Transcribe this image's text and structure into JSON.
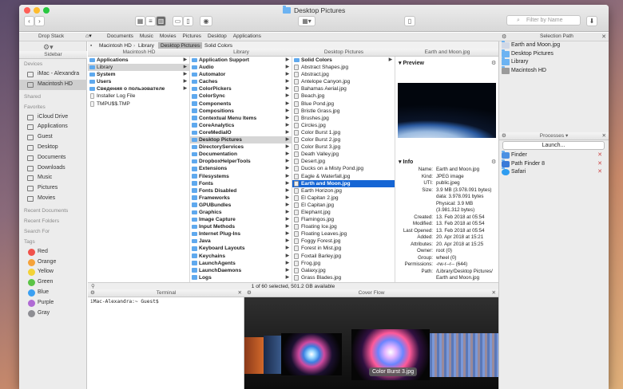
{
  "window": {
    "title": "Desktop Pictures",
    "filter_placeholder": "Filter by Name"
  },
  "pathbar": {
    "items": [
      "Documents",
      "Music",
      "Movies",
      "Pictures",
      "Desktop",
      "Applications"
    ]
  },
  "left_panel": {
    "drop_stack_label": "Drop Stack",
    "sidebar_label": "Sidebar",
    "devices_header": "Devices",
    "devices": [
      "iMac - Alexandra",
      "Macintosh HD"
    ],
    "shared_header": "Shared",
    "favorites_header": "Favorites",
    "favorites": [
      "iCloud Drive",
      "Applications",
      "Guest",
      "Desktop",
      "Documents",
      "Downloads",
      "Music",
      "Pictures",
      "Movies"
    ],
    "recent_docs": "Recent Documents",
    "recent_folders": "Recent Folders",
    "search_for": "Search For",
    "tags_header": "Tags",
    "tags": [
      {
        "name": "Red",
        "color": "#f0524b"
      },
      {
        "name": "Orange",
        "color": "#f5a23a"
      },
      {
        "name": "Yellow",
        "color": "#f3d237"
      },
      {
        "name": "Green",
        "color": "#5bc446"
      },
      {
        "name": "Blue",
        "color": "#3ba0f2"
      },
      {
        "name": "Purple",
        "color": "#b06ad4"
      },
      {
        "name": "Gray",
        "color": "#8e8e93"
      }
    ]
  },
  "breadcrumb": [
    "Macintosh HD",
    "Library",
    "Desktop Pictures",
    "Solid Colors"
  ],
  "columns": {
    "c1": {
      "title": "Macintosh HD",
      "items": [
        {
          "n": "Applications",
          "b": 1,
          "a": 1
        },
        {
          "n": "Library",
          "a": 1,
          "s": 1
        },
        {
          "n": "System",
          "b": 1,
          "a": 1
        },
        {
          "n": "Users",
          "b": 1,
          "a": 1
        },
        {
          "n": "Сведения о пользователе",
          "b": 1,
          "a": 1
        },
        {
          "n": "Installer Log File",
          "d": 1
        },
        {
          "n": "TMPU$$.TMP",
          "d": 1
        }
      ]
    },
    "c2": {
      "title": "Library",
      "items": [
        "Application Support",
        "Audio",
        "Automator",
        "Caches",
        "ColorPickers",
        "ColorSync",
        "Components",
        "Compositions",
        "Contextual Menu Items",
        "CoreAnalytics",
        "CoreMediaIO",
        "Desktop Pictures",
        "DirectoryServices",
        "Documentation",
        "DropboxHelperTools",
        "Extensions",
        "Filesystems",
        "Fonts",
        "Fonts Disabled",
        "Frameworks",
        "GPUBundles",
        "Graphics",
        "Image Capture",
        "Input Methods",
        "Internet Plug-Ins",
        "Java",
        "Keyboard Layouts",
        "Keychains",
        "LaunchAgents",
        "LaunchDaemons",
        "Logs"
      ]
    },
    "c3": {
      "title": "Desktop Pictures",
      "items": [
        "Solid Colors",
        "Abstract Shapes.jpg",
        "Abstract.jpg",
        "Antelope Canyon.jpg",
        "Bahamas Aerial.jpg",
        "Beach.jpg",
        "Blue Pond.jpg",
        "Bristle Grass.jpg",
        "Brushes.jpg",
        "Circles.jpg",
        "Color Burst 1.jpg",
        "Color Burst 2.jpg",
        "Color Burst 3.jpg",
        "Death Valley.jpg",
        "Desert.jpg",
        "Ducks on a Misty Pond.jpg",
        "Eagle & Waterfall.jpg",
        "Earth and Moon.jpg",
        "Earth Horizon.jpg",
        "El Capitan 2.jpg",
        "El Capitan.jpg",
        "Elephant.jpg",
        "Flamingos.jpg",
        "Floating Ice.jpg",
        "Floating Leaves.jpg",
        "Foggy Forest.jpg",
        "Forest in Mist.jpg",
        "Foxtail Barley.jpg",
        "Frog.jpg",
        "Galaxy.jpg",
        "Grass Blades.jpg"
      ]
    },
    "c4": {
      "title": "Earth and Moon.jpg"
    }
  },
  "preview": {
    "label": "Preview"
  },
  "info": {
    "label": "Info",
    "rows": [
      [
        "Name:",
        "Earth and Moon.jpg"
      ],
      [
        "Kind:",
        "JPEG image"
      ],
      [
        "UTI:",
        "public.jpeg"
      ],
      [
        "Size:",
        "3.9 MB (3.978.091 bytes)"
      ],
      [
        "",
        "data: 3.978.091 bytes"
      ],
      [
        "",
        "Physical: 3.9 MB"
      ],
      [
        "",
        "(3.981.312 bytes)"
      ],
      [
        "Created:",
        "13. Feb 2018 at 05:54"
      ],
      [
        "Modified:",
        "13. Feb 2018 at 05:54"
      ],
      [
        "Last Opened:",
        "13. Feb 2018 at 05:54"
      ],
      [
        "Added:",
        "20. Apr 2018 at 15:21"
      ],
      [
        "Attributes:",
        "20. Apr 2018 at 15:25"
      ],
      [
        "Owner:",
        "root (0)"
      ],
      [
        "Group:",
        "wheel (0)"
      ],
      [
        "Permissions:",
        "-rw-r--r-- (644)"
      ],
      [
        "Path:",
        "/Library/Desktop Pictures/"
      ],
      [
        "",
        "Earth and Moon.jpg"
      ]
    ]
  },
  "status": "1 of 60 selected, 501.2 GB available",
  "terminal": {
    "label": "Terminal",
    "prompt": "iMac-Alexandra:~ Guest$"
  },
  "coverflow": {
    "label": "Cover Flow",
    "caption": "Color Burst 3.jpg"
  },
  "selection_path": {
    "label": "Selection Path",
    "items": [
      "Earth and Moon.jpg",
      "Desktop Pictures",
      "Library",
      "Macintosh HD"
    ]
  },
  "processes": {
    "label": "Processes",
    "launch": "Launch...",
    "items": [
      "Finder",
      "Path Finder 8",
      "Safari"
    ]
  }
}
